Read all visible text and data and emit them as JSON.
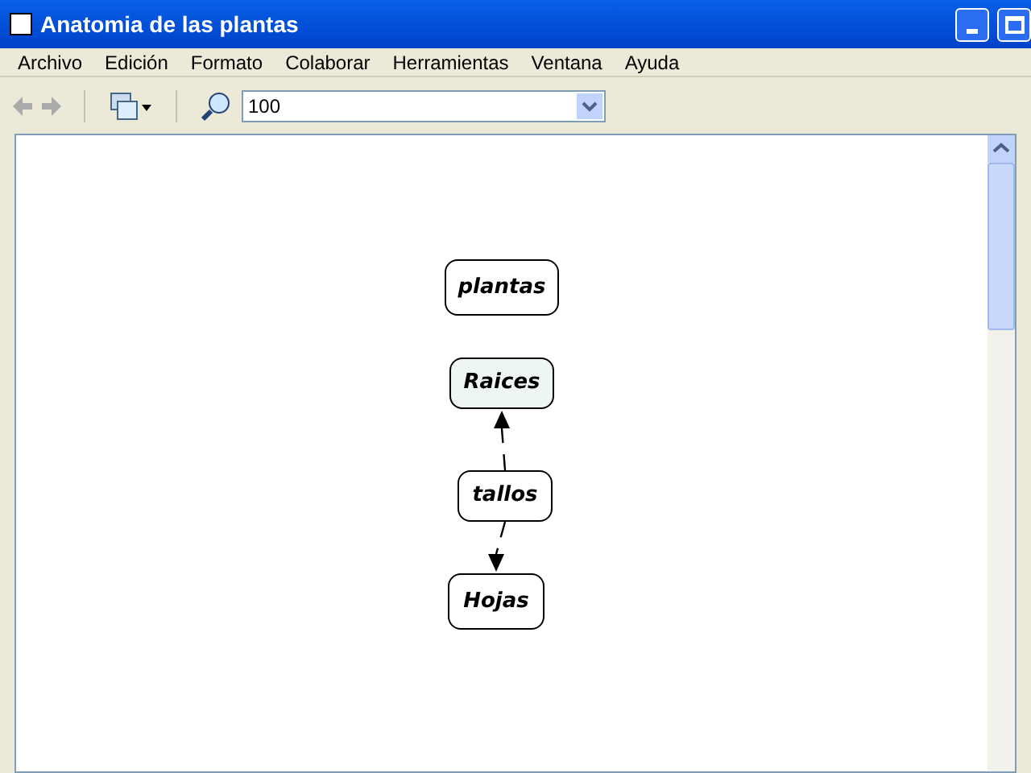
{
  "window": {
    "title": "Anatomia de las plantas"
  },
  "menu": [
    "Archivo",
    "Edición",
    "Formato",
    "Colaborar",
    "Herramientas",
    "Ventana",
    "Ayuda"
  ],
  "toolbar": {
    "zoom": "100"
  },
  "concepts": [
    {
      "label": "plantas",
      "selected": false
    },
    {
      "label": "Raices",
      "selected": true
    },
    {
      "label": "tallos",
      "selected": false
    },
    {
      "label": "Hojas",
      "selected": false
    }
  ]
}
